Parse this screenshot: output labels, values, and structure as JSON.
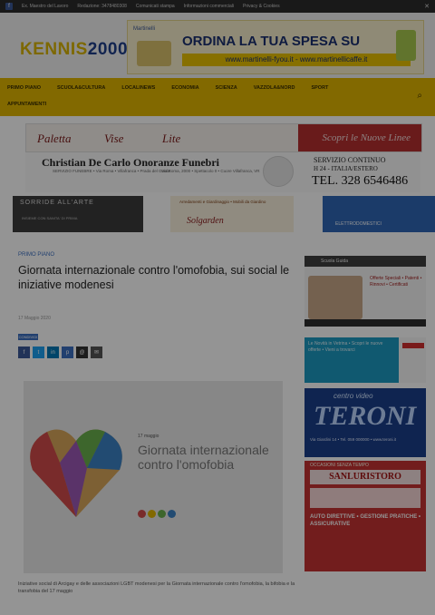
{
  "topbar": {
    "items": [
      "Ex. Maestro del Lavoro",
      "Redazione: 3478480308",
      "Comunicati stampa",
      "Informazioni commerciali",
      "Privacy & Cookies"
    ]
  },
  "header": {
    "logo_part1": "KENNIS",
    "logo_part2": "2000",
    "banner_brand": "Martinelli",
    "banner_headline": "ORDINA LA TUA SPESA SU",
    "banner_url": "www.martinelli-fyou.it - www.martinellicaffe.it"
  },
  "nav": {
    "row1": [
      "PRIMO PIANO",
      "SCUOLA&CULTURA",
      "LOCALINEWS",
      "ECONOMIA",
      "SCIENZA",
      "VAZZOLA&NORD",
      "SPORT"
    ],
    "row2": [
      "APPUNTAMENTI"
    ]
  },
  "ads": {
    "ad1_left": [
      "Paletta",
      "Vise",
      "Lite"
    ],
    "ad1_right": "Scopri le Nuove Linee",
    "ad2_name": "Christian De Carlo  Onoranze Funebri",
    "ad2_sub1": "SERVIZIO FUNEBRE • Via Roma • Villafranca • Prada del Garda",
    "ad2_sub2": "Via Roma, 2000 • Spettacolo 0  • Cuore Villafranca, VR",
    "ad2_service": "SERVIZIO CONTINUO",
    "ad2_service_sub": "H 24 - ITALIA/ESTERO",
    "ad2_tel": "TEL. 328 6546486",
    "ad3a_title": "SORRIDE ALL'ARTE",
    "ad3a_sub": "INSIEME CON SANITA' DI PRIMA",
    "ad3b_text": "Arredamenti e Giardinaggio  •  Mobili da Giardino",
    "ad3b_brand": "Solgarden",
    "ad3c_text": "ELETTRODOMESTICI"
  },
  "article": {
    "category": "PRIMO PIANO",
    "title": "Giornata internazionale contro l'omofobia, sui social le iniziative modenesi",
    "date": "17 Maggio 2020",
    "badge": "CONDIVIDI",
    "share_buttons": [
      "f",
      "t",
      "in",
      "p",
      "@",
      "✉"
    ],
    "image_label": "17 maggio",
    "image_text": "Giornata internazionale contro l'omofobia",
    "caption": "Iniziative social di Arcigay e delle associazioni LGBT modenesi per la Giornata internazionale contro l'omofobia, la bifobia e la transfobia del 17 maggio"
  },
  "sidebar": {
    "ad1_header": "Scuola Guida",
    "ad1_text": "Offerte Speciali  • Patenti  • Rinnovi  • Certificati",
    "ad2_text": "Le Novità in Vetrina  • Scopri le nuove offerte  • Vieni a trovarci",
    "ad3_tag": "centro video",
    "ad3_name": "TERONI",
    "ad3_text": "Via Giardini 14 • Tel. 059 000000 • www.teroni.it",
    "ad4_tag": "OCCASIONI SENZA TEMPO",
    "ad4_name": "SANLURISTORO",
    "ad4_text": "AUTO DIRETTIVE  • GESTIONE PRATICHE  • ASSICURATIVE"
  },
  "colors": {
    "nav": "#e0b500",
    "accent_blue": "#3b6ec0",
    "overlay": "rgba(0,0,0,0.42)"
  }
}
